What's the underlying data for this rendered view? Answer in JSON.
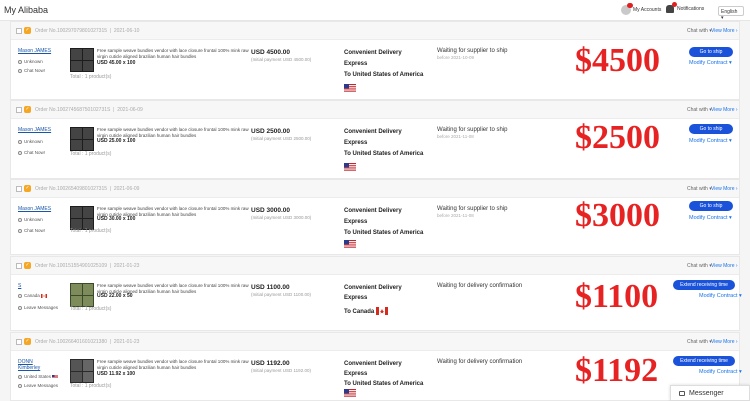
{
  "header": {
    "brand": "My Alibaba",
    "account_label": "My Accounts",
    "notifications_label": "Notifications",
    "language": "English"
  },
  "orders": [
    {
      "order_no": "Order No.100297079801027315",
      "date": "2021-06-10",
      "buyer": "Mason JAMES",
      "location": "Unknown",
      "contact": "Chat Now!",
      "description": "Free sample weave bundles vendor with lace closure frontal 100% mink raw virgin cuticle aligned brazilian human hair bundles",
      "qty": "USD 45.00 x 100",
      "total_products": "Total : 1 product(s)",
      "price": "USD 4500.00",
      "initial_payment": "(Initial payment USD 4500.00)",
      "ship_method": "Convenient Delivery",
      "ship_mode": "Express",
      "destination": "To United States of America",
      "status": "Waiting for supplier to ship",
      "before": "before 2021-10-09",
      "big_price": "$4500",
      "action": "Go to ship",
      "modify": "Modify Contract"
    },
    {
      "order_no": "Order No.100274568750102731S",
      "date": "2021-06-09",
      "buyer": "Mason JAMES",
      "location": "Unknown",
      "contact": "Chat Now!",
      "description": "Free sample weave bundles vendor with lace closure frontal 100% mink raw virgin cuticle aligned brazilian human hair bundles",
      "qty": "USD 25.00 x 100",
      "total_products": "Total : 1 product(s)",
      "price": "USD 2500.00",
      "initial_payment": "(Initial payment USD 2500.00)",
      "ship_method": "Convenient Delivery",
      "ship_mode": "Express",
      "destination": "To United States of America",
      "status": "Waiting for supplier to ship",
      "before": "before 2021-11-08",
      "big_price": "$2500",
      "action": "Go to ship",
      "modify": "Modify Contract"
    },
    {
      "order_no": "Order No.100265409801027315",
      "date": "2021-06-09",
      "buyer": "Mason JAMES",
      "location": "Unknown",
      "contact": "Chat Now!",
      "description": "Free sample weave bundles vendor with lace closure frontal 100% mink raw virgin cuticle aligned brazilian human hair bundles",
      "qty": "USD 30.00 x 100",
      "total_products": "Total : 1 product(s)",
      "price": "USD 3000.00",
      "initial_payment": "(Initial payment USD 3000.00)",
      "ship_method": "Convenient Delivery",
      "ship_mode": "Express",
      "destination": "To United States of America",
      "status": "Waiting for supplier to ship",
      "before": "before 2021-11-08",
      "big_price": "$3000",
      "action": "Go to ship",
      "modify": "Modify Contract"
    },
    {
      "order_no": "Order No.100151554901025109",
      "date": "2021-01-23",
      "buyer": "S",
      "location": "Canada",
      "contact": "Leave Messages",
      "description": "Free sample weave bundles vendor with lace closure frontal 100% mink raw virgin cuticle aligned brazilian human hair bundles",
      "qty": "USD 22.00 x 50",
      "total_products": "Total : 1 product(s)",
      "price": "USD 1100.00",
      "initial_payment": "(Initial payment USD 1100.00)",
      "ship_method": "Convenient Delivery",
      "ship_mode": "Express",
      "destination": "To Canada",
      "status": "Waiting for delivery confirmation",
      "before": "",
      "big_price": "$1100",
      "action": "Extend receiving time",
      "modify": "Modify Contract"
    },
    {
      "order_no": "Order No.100266401601021380",
      "date": "2021-01-23",
      "buyer": "DONN Kimberley",
      "location": "United States",
      "contact": "Leave Messages",
      "description": "Free sample weave bundles vendor with lace closure frontal 100% mink raw virgin cuticle aligned brazilian human hair bundles",
      "qty": "USD 11.92 x 100",
      "total_products": "Total : 1 product(s)",
      "price": "USD 1192.00",
      "initial_payment": "(Initial payment USD 1192.00)",
      "ship_method": "Convenient Delivery",
      "ship_mode": "Express",
      "destination": "To United States of America",
      "status": "Waiting for delivery confirmation",
      "before": "",
      "big_price": "$1192",
      "action": "Extend receiving time",
      "modify": "Modify Contract"
    }
  ],
  "card_header": {
    "chat_with": "Chat with",
    "view_more": "View More"
  },
  "messenger": {
    "label": "Messenger"
  }
}
